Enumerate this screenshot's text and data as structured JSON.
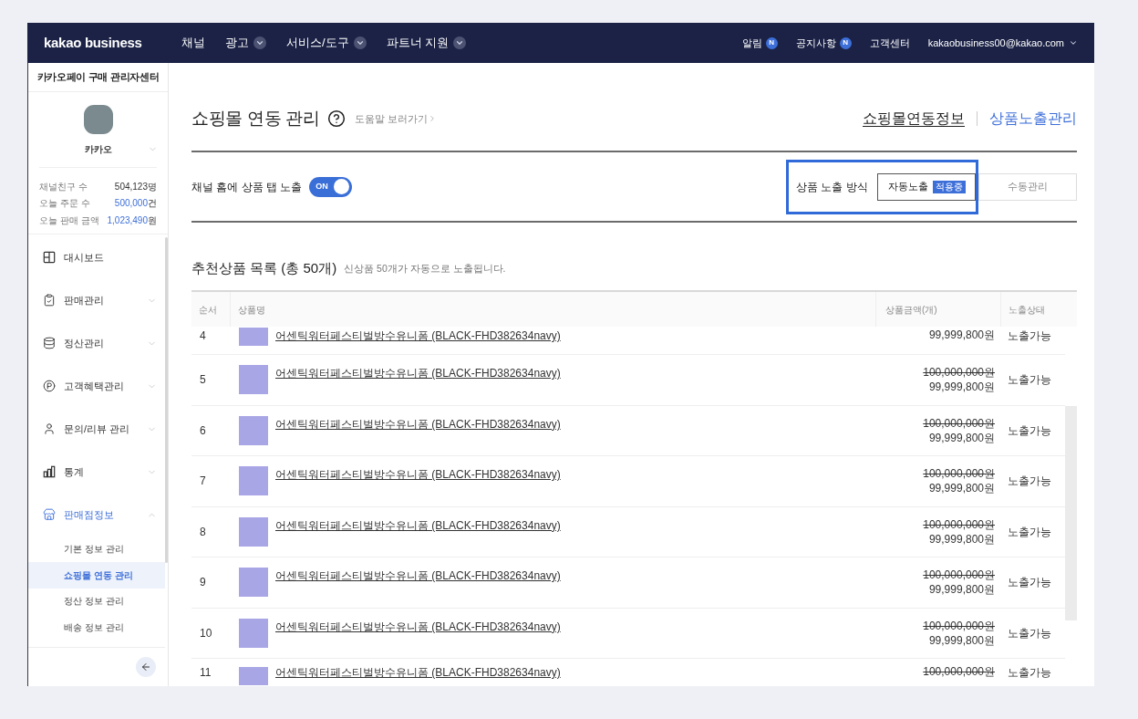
{
  "nav": {
    "logo": "kakao business",
    "menu": [
      {
        "label": "채널",
        "kind": "link"
      },
      {
        "label": "광고",
        "kind": "dropdown"
      },
      {
        "label": "서비스/도구",
        "kind": "dropdown"
      },
      {
        "label": "파트너 지원",
        "kind": "dropdown"
      }
    ],
    "utilities": [
      {
        "label": "알림",
        "badge": "N"
      },
      {
        "label": "공지사항",
        "badge": "N"
      },
      {
        "label": "고객센터"
      }
    ],
    "account": "kakaobusiness00@kakao.com"
  },
  "sidebar": {
    "title": "카카오페이 구매 관리자센터",
    "profile": {
      "name": "카카오"
    },
    "stats": [
      {
        "label": "채널친구 수",
        "value": "504,123",
        "unit": "명",
        "highlight": false
      },
      {
        "label": "오늘 주문 수",
        "value": "500,000",
        "unit": "건",
        "highlight": true
      },
      {
        "label": "오늘 판매 금액",
        "value": "1,023,490",
        "unit": "원",
        "highlight": true
      }
    ],
    "menu": [
      {
        "label": "대시보드",
        "kind": "link"
      },
      {
        "label": "판매관리",
        "kind": "group",
        "expanded": false
      },
      {
        "label": "정산관리",
        "kind": "group",
        "expanded": false
      },
      {
        "label": "고객혜택관리",
        "kind": "group",
        "expanded": false
      },
      {
        "label": "문의/리뷰 관리",
        "kind": "group",
        "expanded": false
      },
      {
        "label": "통계",
        "kind": "group",
        "expanded": false
      },
      {
        "label": "판매점정보",
        "kind": "group",
        "expanded": true,
        "children": [
          {
            "label": "기본 정보 관리",
            "selected": false
          },
          {
            "label": "쇼핑몰 연동 관리",
            "selected": true
          },
          {
            "label": "정산 정보 관리",
            "selected": false
          },
          {
            "label": "배송 정보 관리",
            "selected": false
          }
        ]
      }
    ]
  },
  "page": {
    "title": "쇼핑몰 연동 관리",
    "help_link": "도움말 보러가기",
    "tabs": [
      {
        "label": "쇼핑몰연동정보",
        "selected": false
      },
      {
        "label": "상품노출관리",
        "selected": true
      }
    ]
  },
  "settings": {
    "toggle": {
      "label": "채널 홈에 상품 탭 노출",
      "on": true,
      "text": "ON"
    },
    "exposure_method": {
      "label": "상품 노출 방식",
      "highlighted": true,
      "options": [
        {
          "label": "자동노출",
          "badge": "적용중",
          "selected": true
        },
        {
          "label": "수동관리",
          "selected": false
        }
      ]
    }
  },
  "product_list": {
    "title": "추천상품 목록 (총 50개)",
    "note": "신상품 50개가 자동으로 노출됩니다.",
    "table": {
      "columns": [
        "순서",
        "상품명",
        "상품금액(개)",
        "노출상태"
      ],
      "rows": [
        {
          "kind": "clipped_top",
          "no": "4",
          "name": "어센틱워터페스티벌방수유니폼 (BLACK-FHD382634navy)",
          "sale_price": "99,999,800원",
          "status": "노출가능"
        },
        {
          "kind": "full",
          "no": "5",
          "name": "어센틱워터페스티벌방수유니폼 (BLACK-FHD382634navy)",
          "list_price": "100,000,000원",
          "sale_price": "99,999,800원",
          "status": "노출가능"
        },
        {
          "kind": "full",
          "no": "6",
          "name": "어센틱워터페스티벌방수유니폼 (BLACK-FHD382634navy)",
          "list_price": "100,000,000원",
          "sale_price": "99,999,800원",
          "status": "노출가능"
        },
        {
          "kind": "full",
          "no": "7",
          "name": "어센틱워터페스티벌방수유니폼 (BLACK-FHD382634navy)",
          "list_price": "100,000,000원",
          "sale_price": "99,999,800원",
          "status": "노출가능"
        },
        {
          "kind": "full",
          "no": "8",
          "name": "어센틱워터페스티벌방수유니폼 (BLACK-FHD382634navy)",
          "list_price": "100,000,000원",
          "sale_price": "99,999,800원",
          "status": "노출가능"
        },
        {
          "kind": "full",
          "no": "9",
          "name": "어센틱워터페스티벌방수유니폼 (BLACK-FHD382634navy)",
          "list_price": "100,000,000원",
          "sale_price": "99,999,800원",
          "status": "노출가능"
        },
        {
          "kind": "full",
          "no": "10",
          "name": "어센틱워터페스티벌방수유니폼 (BLACK-FHD382634navy)",
          "list_price": "100,000,000원",
          "sale_price": "99,999,800원",
          "status": "노출가능"
        },
        {
          "kind": "clipped_bottom",
          "no": "11",
          "name": "어센틱워터페스티벌방수유니폼 (BLACK-FHD382634navy)",
          "list_price": "100,000,000원",
          "status": "노출가능"
        }
      ]
    }
  }
}
